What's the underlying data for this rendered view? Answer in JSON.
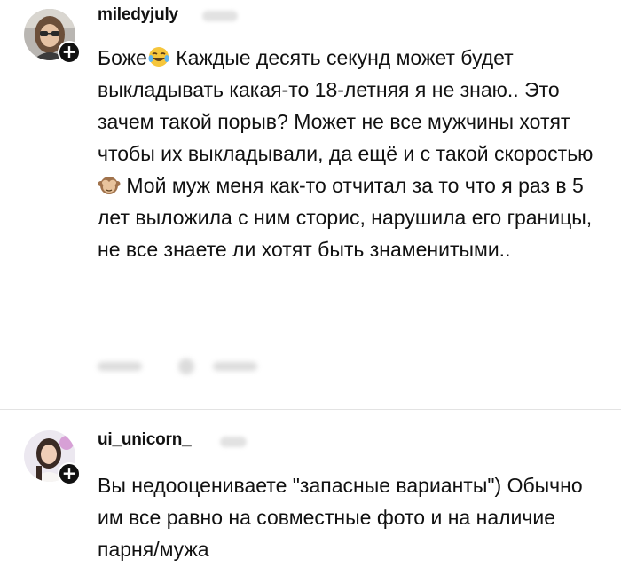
{
  "comments": [
    {
      "username": "miledyjuly",
      "text_part1": "Боже",
      "emoji1": "joy-emoji",
      "text_part2": " Каждые десять секунд может будет выкладывать какая-то 18-летняя я не знаю.. Это зачем такой порыв? Может не все мужчины хотят чтобы их выкладывали, да ещё и с такой скоростью ",
      "emoji2": "see-no-evil-emoji",
      "text_part3": " Мой муж меня как-то отчитал за то что я раз в 5 лет выложила с ним сторис, нарушила его границы, не все знаете ли хотят быть знаменитыми..",
      "follow_icon": "plus-icon"
    },
    {
      "username": "ui_unicorn_",
      "text": "Вы недооцениваете \"запасные варианты\") Обычно им все равно на совместные фото и на наличие парня/мужа",
      "follow_icon": "plus-icon"
    }
  ],
  "colors": {
    "text": "#111111",
    "divider": "#e3e3e3",
    "background": "#ffffff"
  }
}
